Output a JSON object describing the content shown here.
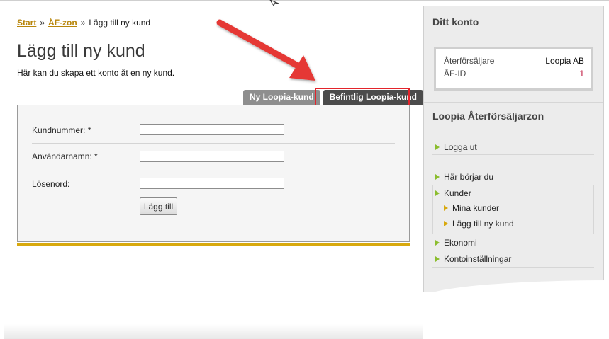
{
  "breadcrumb": {
    "start": "Start",
    "separator": "»",
    "af_zone": "ÅF-zon",
    "current": "Lägg till ny kund"
  },
  "page": {
    "title": "Lägg till ny kund",
    "intro": "Här kan du skapa ett konto åt en ny kund."
  },
  "tabs": [
    {
      "label": "Ny Loopia-kund"
    },
    {
      "label": "Befintlig Loopia-kund",
      "highlighted": true
    }
  ],
  "form": {
    "fields": [
      {
        "label": "Kundnummer: *",
        "value": ""
      },
      {
        "label": "Användarnamn: *",
        "value": ""
      },
      {
        "label": "Lösenord:",
        "value": ""
      }
    ],
    "submit_label": "Lägg till"
  },
  "sidebar": {
    "account_heading": "Ditt konto",
    "account": {
      "reseller_label": "Återförsäljare",
      "reseller_value": "Loopia AB",
      "af_id_label": "ÅF-ID",
      "af_id_value": "1"
    },
    "zone_heading": "Loopia Återförsäljarzon",
    "logout": "Logga ut",
    "nav": {
      "start_here": "Här börjar du",
      "customers": "Kunder",
      "my_customers": "Mina kunder",
      "add_customer": "Lägg till ny kund",
      "economy": "Ekonomi",
      "account_settings": "Kontoinställningar"
    }
  },
  "colors": {
    "accent_gold": "#d8a90e",
    "bullet_green": "#8bbd2e",
    "highlight_red": "#e3242b",
    "af_id_red": "#c0143c"
  },
  "icons": {
    "arrow": "red-arrow-icon",
    "bullet": "triangle-bullet-icon",
    "cursor": "mouse-cursor-icon"
  }
}
